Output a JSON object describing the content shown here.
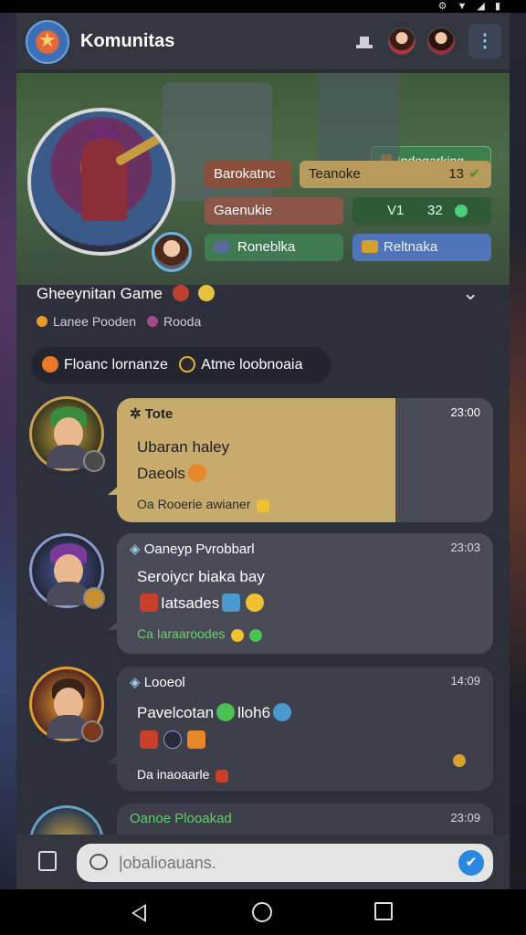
{
  "header": {
    "title": "Komunitas",
    "icons": [
      "app-logo",
      "hat-icon",
      "user-avatar",
      "user-avatar",
      "more-vertical-icon"
    ]
  },
  "banner": {
    "tag": "Indogarking",
    "stats": [
      {
        "label": "Barokatnc"
      },
      {
        "label": "Teanoke",
        "value": "13"
      },
      {
        "label": "Gaenukie"
      },
      {
        "label": "V1",
        "value": "32"
      },
      {
        "label": "Roneblka"
      },
      {
        "label": "Reltnaka"
      }
    ]
  },
  "profile": {
    "name": "Gheeynitan Game",
    "meta": "Lanee Pooden",
    "meta_tag": "Rooda",
    "status_left": "Floanc lornanze",
    "status_right": "Atme loobnoaia"
  },
  "messages": [
    {
      "sender": "Tote",
      "time": "23:00",
      "line1": "Ubaran haley",
      "line2": "Daeols",
      "footer": "Oa Rooerie awianer"
    },
    {
      "sender": "Oaneyp Pvrobbarl",
      "time": "23:03",
      "line1": "Seroiycr biaka bay",
      "line2": "Iatsades",
      "footer": "Ca Iaraaroodes"
    },
    {
      "sender": "Looeol",
      "time": "14:09",
      "line1": "Pavelcotan",
      "line1b": "lloh6",
      "footer": "Da inaoaarle"
    },
    {
      "sender": "Oanoe Plooakad",
      "time": "23:09"
    }
  ],
  "composer": {
    "placeholder": "|obalioauans."
  },
  "colors": {
    "accent": "#2a88e0",
    "gold_bubble": "#c6ab6d",
    "green_text": "#6ad070"
  }
}
